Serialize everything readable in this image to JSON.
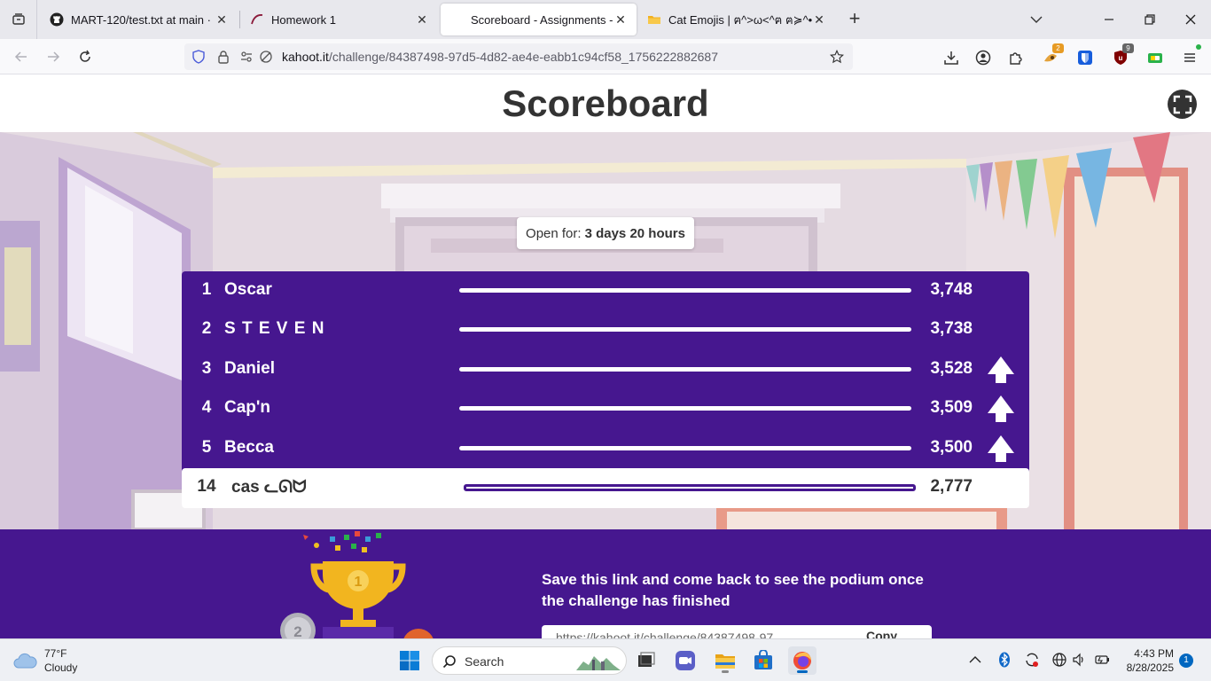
{
  "browser": {
    "tabs": [
      {
        "title": "MART-120/test.txt at main · sea",
        "icon": "github-icon"
      },
      {
        "title": "Homework 1",
        "icon": "canvas-icon"
      },
      {
        "title": "Scoreboard - Assignments - Kal",
        "icon": "kahoot-icon",
        "active": true
      },
      {
        "title": "Cat Emojis | ฅ^>ω<^ฅ ฅ≽^•⩊•",
        "icon": "folder-icon"
      }
    ],
    "url_host": "kahoot.it",
    "url_path": "/challenge/84387498-97d5-4d82-ae4e-eabb1c94cf58_1756222882687",
    "badges": {
      "extension_a": "2",
      "extension_b": "9"
    }
  },
  "page": {
    "title": "Scoreboard",
    "open_for_label": "Open for:",
    "open_for_value": "3 days 20 hours",
    "players": [
      {
        "rank": "1",
        "name": "Oscar",
        "score": "3,748",
        "moved_up": false
      },
      {
        "rank": "2",
        "name": "S T E V E N",
        "score": "3,738",
        "moved_up": false
      },
      {
        "rank": "3",
        "name": "Daniel",
        "score": "3,528",
        "moved_up": true
      },
      {
        "rank": "4",
        "name": "Cap'n",
        "score": "3,509",
        "moved_up": true
      },
      {
        "rank": "5",
        "name": "Becca",
        "score": "3,500",
        "moved_up": true
      }
    ],
    "me": {
      "rank": "14",
      "name": "cas ᓚᘏᗢ",
      "score": "2,777"
    },
    "save_message": "Save this link and come back to see the podium once the challenge has finished",
    "link_value": "https://kahoot.it/challenge/84387498-97",
    "copy_label": "Copy",
    "podium_numbers": [
      "1",
      "2"
    ],
    "colors": {
      "purple": "#46178f",
      "text": "#333333"
    }
  },
  "taskbar": {
    "weather_temp": "77°F",
    "weather_desc": "Cloudy",
    "search_label": "Search",
    "time": "4:43 PM",
    "date": "8/28/2025",
    "notifications": "1"
  }
}
